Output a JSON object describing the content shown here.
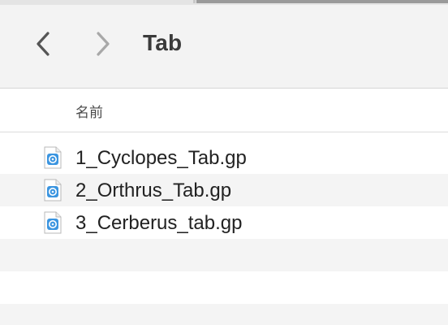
{
  "window": {
    "title": "Tab"
  },
  "toolbar": {
    "back_icon": "chevron-left-icon",
    "forward_icon": "chevron-right-icon"
  },
  "list": {
    "column_name": "名前",
    "files": [
      {
        "name": "1_Cyclopes_Tab.gp",
        "icon": "guitar-pro-file-icon"
      },
      {
        "name": "2_Orthrus_Tab.gp",
        "icon": "guitar-pro-file-icon"
      },
      {
        "name": "3_Cerberus_tab.gp",
        "icon": "guitar-pro-file-icon"
      }
    ]
  },
  "colors": {
    "toolbar_bg": "#f3f3f3",
    "alt_row_bg": "#f4f4f4",
    "file_icon_blue": "#3b95e0"
  }
}
